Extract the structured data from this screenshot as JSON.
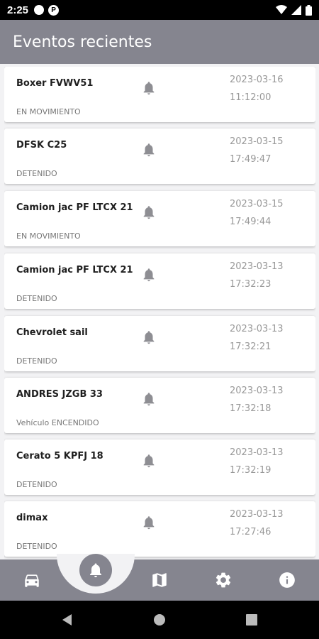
{
  "status_bar": {
    "time": "2:25",
    "p_icon_letter": "P"
  },
  "app_bar": {
    "title": "Eventos recientes"
  },
  "events": [
    {
      "name": "Boxer FVWV51",
      "status": "EN MOVIMIENTO",
      "date": "2023-03-16\n11:12:00"
    },
    {
      "name": "DFSK C25",
      "status": "DETENIDO",
      "date": "2023-03-15\n17:49:47"
    },
    {
      "name": "Camion jac PF LTCX 21",
      "status": "EN MOVIMIENTO",
      "date": "2023-03-15\n17:49:44"
    },
    {
      "name": "Camion jac PF LTCX 21",
      "status": "DETENIDO",
      "date": "2023-03-13\n17:32:23"
    },
    {
      "name": "Chevrolet sail",
      "status": "DETENIDO",
      "date": "2023-03-13\n17:32:21"
    },
    {
      "name": "ANDRES JZGB 33",
      "status": "Vehículo ENCENDIDO",
      "date": "2023-03-13\n17:32:18"
    },
    {
      "name": "Cerato 5 KPFJ 18",
      "status": "DETENIDO",
      "date": "2023-03-13\n17:32:19"
    },
    {
      "name": "dimax",
      "status": "DETENIDO",
      "date": "2023-03-13\n17:27:46"
    }
  ],
  "bottom_nav": {
    "items": [
      "car-icon",
      "bell-icon",
      "map-icon",
      "gear-icon",
      "info-icon"
    ],
    "active": "bell-icon"
  },
  "colors": {
    "appbar": "#85858f",
    "background": "#f2f2f4",
    "bell": "#8e8e93"
  }
}
